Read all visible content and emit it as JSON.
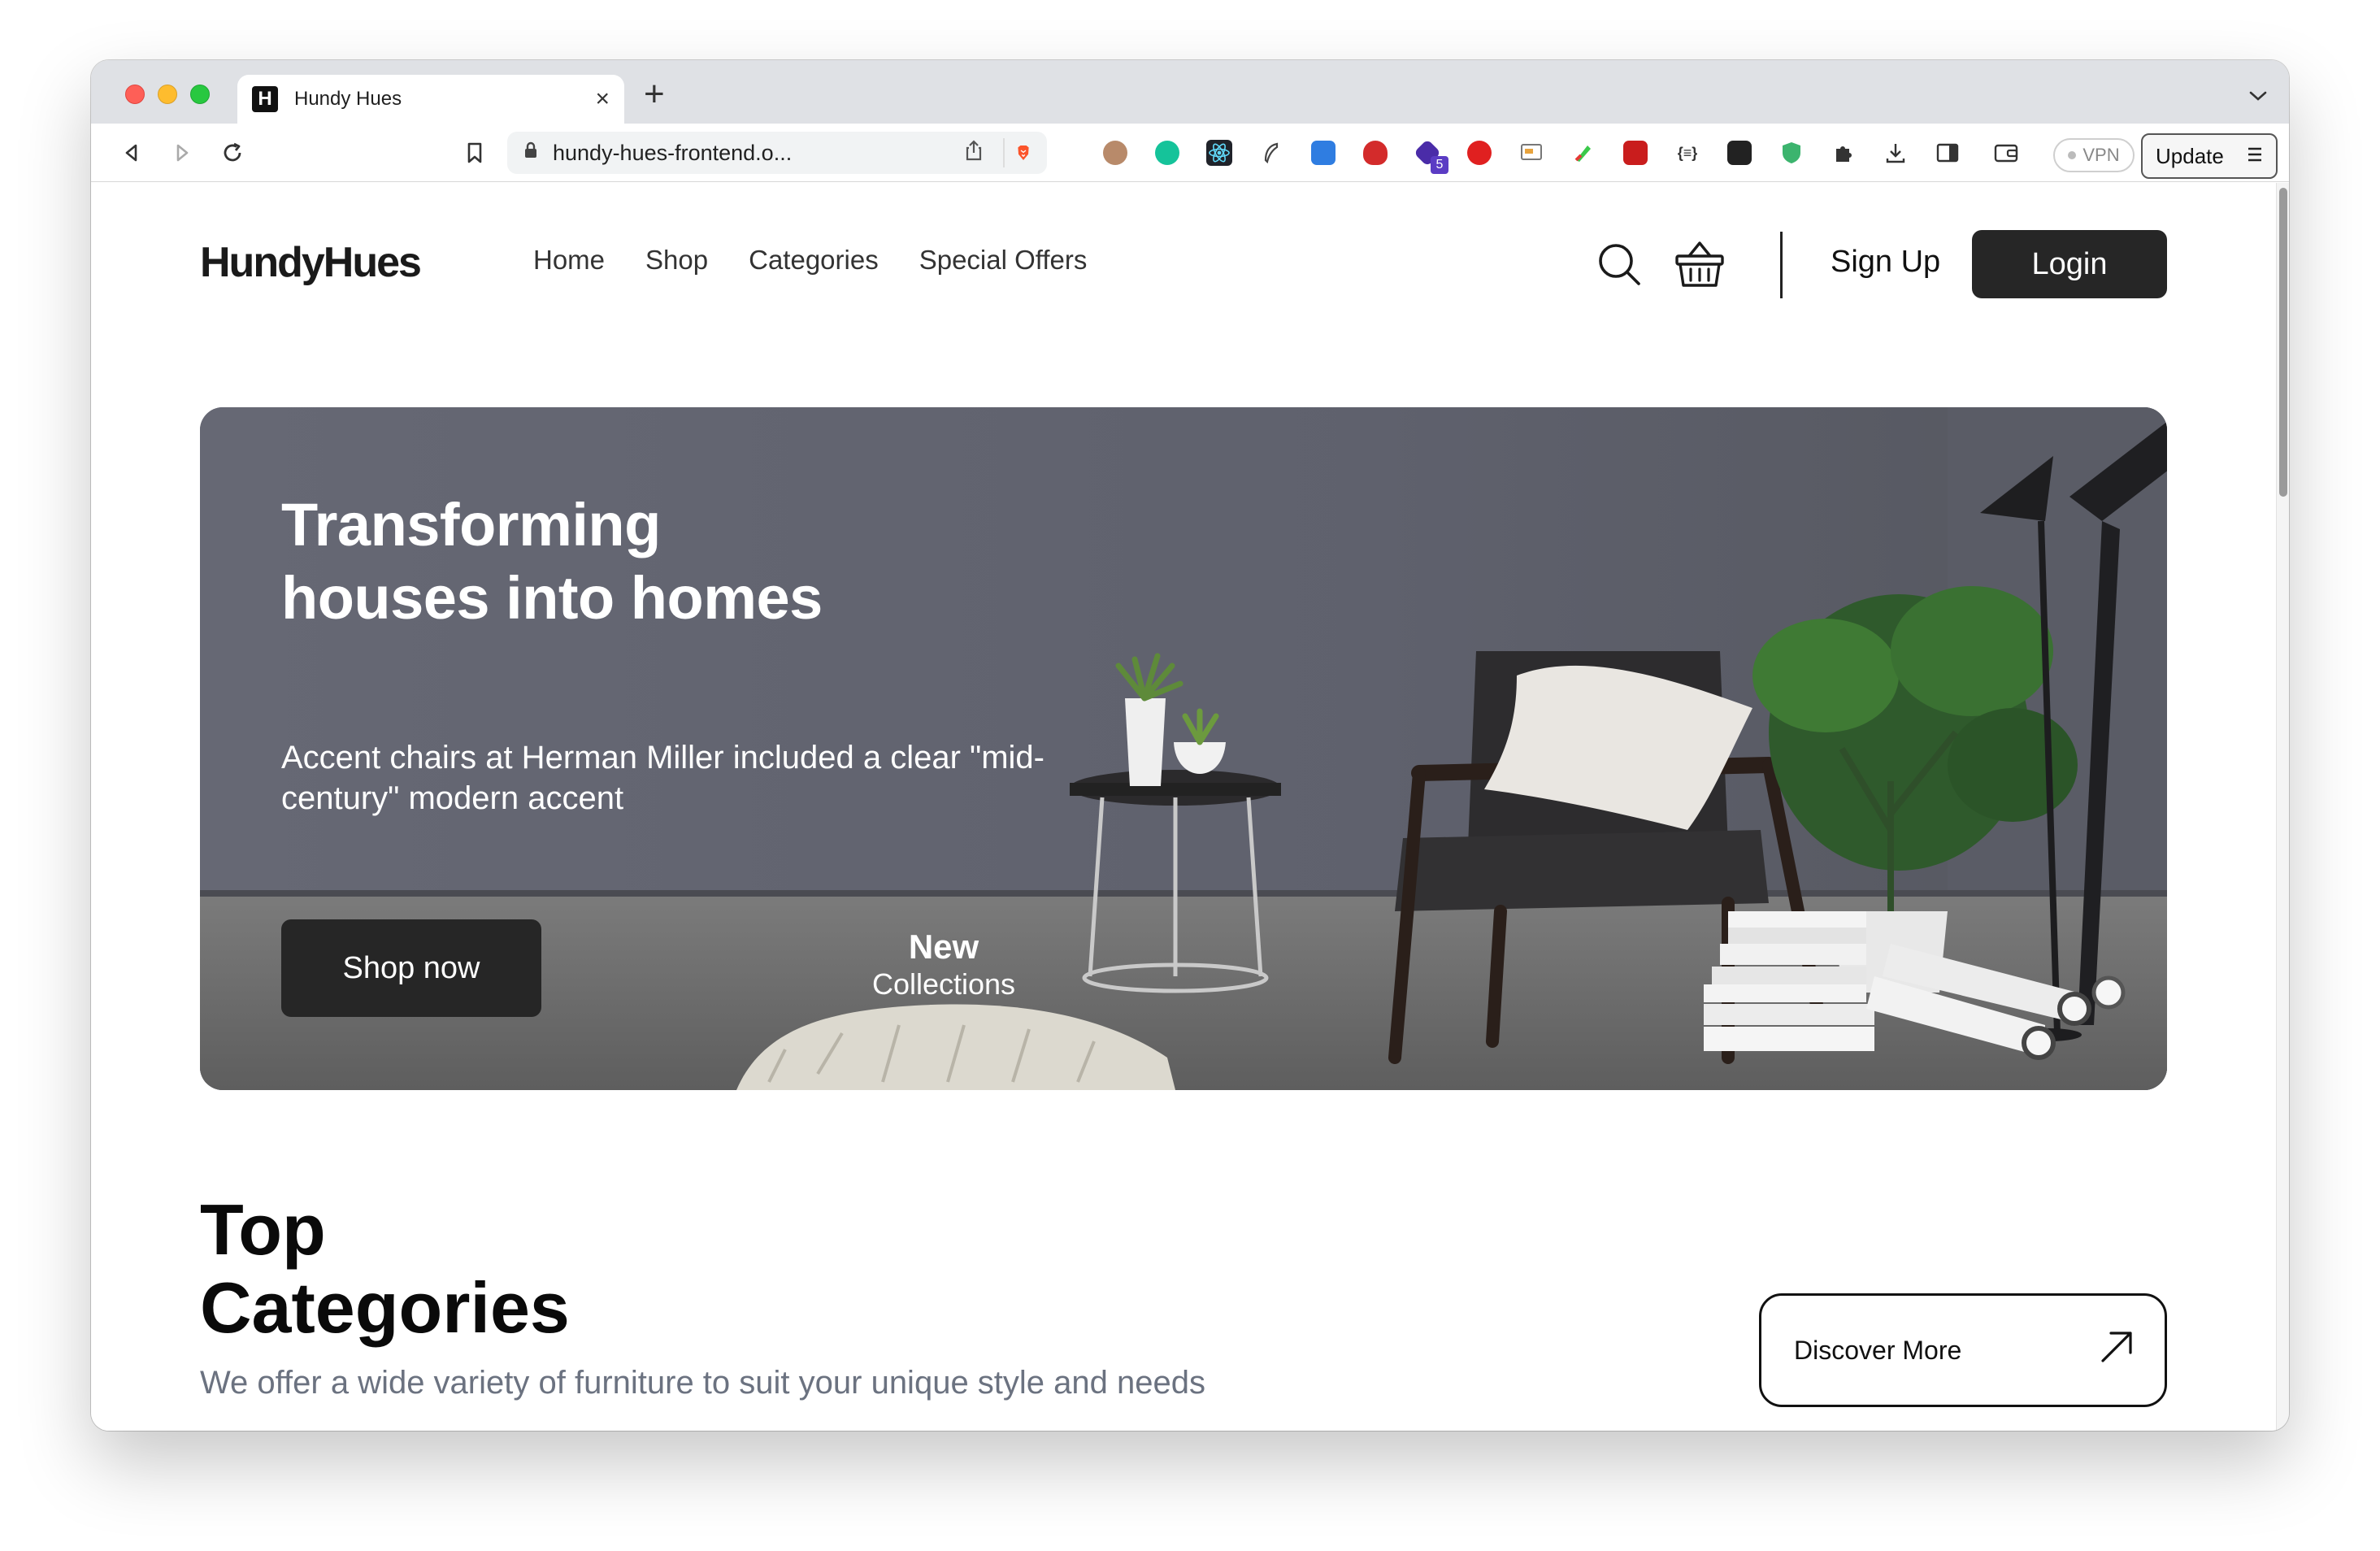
{
  "browser": {
    "tab_title": "Hundy Hues",
    "tab_favicon_letter": "H",
    "new_tab_symbol": "+",
    "close_symbol": "×",
    "url": "hundy-hues-frontend.o...",
    "vpn_label": "VPN",
    "update_label": "Update",
    "extension_badge": "5",
    "extension_code_label": "{≡}"
  },
  "site": {
    "logo": "HundyHues",
    "nav": [
      "Home",
      "Shop",
      "Categories",
      "Special Offers"
    ],
    "signup_label": "Sign Up",
    "login_label": "Login"
  },
  "hero": {
    "title": "Transforming houses into homes",
    "subtitle": "Accent chairs at Herman Miller included a clear \"mid-century\" modern accent",
    "cta_label": "Shop now",
    "badge_line1": "New",
    "badge_line2": "Collections"
  },
  "top_categories": {
    "title_line1": "Top",
    "title_line2": "Categories",
    "subtitle": "We offer a wide variety of furniture to suit your unique style and needs",
    "discover_label": "Discover More"
  },
  "colors": {
    "accent_dark": "#262626",
    "hero_wall": "#636571",
    "muted_text": "#6b7280"
  }
}
